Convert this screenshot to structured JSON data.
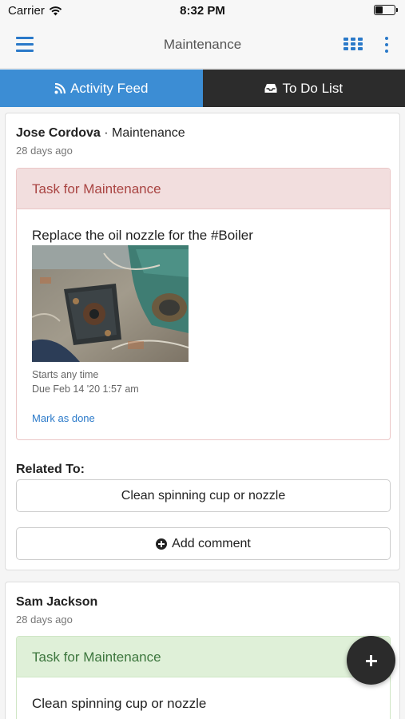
{
  "status_bar": {
    "carrier": "Carrier",
    "time": "8:32 PM"
  },
  "nav": {
    "title": "Maintenance"
  },
  "tabs": [
    {
      "label": "Activity Feed",
      "icon": "rss-icon",
      "active": true
    },
    {
      "label": "To Do List",
      "icon": "inbox-icon",
      "active": false
    }
  ],
  "feed": [
    {
      "author": "Jose Cordova",
      "separator": " · ",
      "group": "Maintenance",
      "time": "28 days ago",
      "task_header": "Task for Maintenance",
      "task_text": "Replace the oil nozzle for the #Boiler",
      "starts": "Starts any time",
      "due": "Due Feb 14 '20 1:57 am",
      "mark_done": "Mark as done",
      "related_label": "Related To:",
      "related_item": "Clean spinning cup or nozzle",
      "add_comment": "Add comment"
    },
    {
      "author": "Sam Jackson",
      "time": "28 days ago",
      "task_header": "Task for Maintenance",
      "task_text": "Clean spinning cup or nozzle"
    }
  ],
  "colors": {
    "accent": "#2a79c9",
    "tab_active": "#3c8dd4",
    "tab_inactive": "#2c2c2c",
    "task_red_bg": "#f2dede",
    "task_red_text": "#a94442",
    "task_green_bg": "#dff0d8",
    "task_green_text": "#3c763d"
  }
}
